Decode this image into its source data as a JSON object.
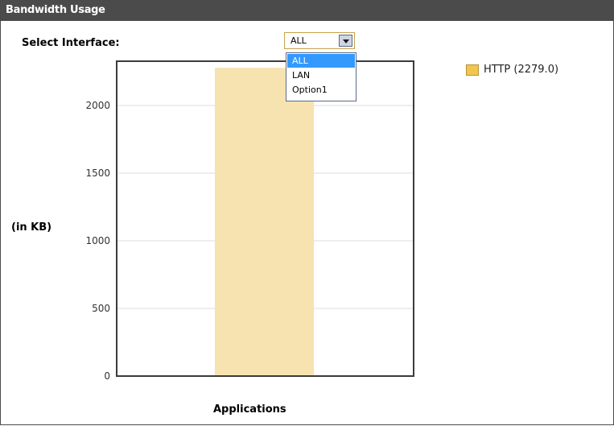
{
  "panel": {
    "title": "Bandwidth Usage",
    "select_label": "Select Interface:",
    "select": {
      "value": "ALL",
      "options": [
        "ALL",
        "LAN",
        "Option1"
      ],
      "selected_index": 0
    }
  },
  "chart_data": {
    "type": "bar",
    "categories": [
      "HTTP"
    ],
    "values": [
      2279.0
    ],
    "ylabel": "(in KB)",
    "xlabel": "Applications",
    "ylim": [
      0,
      2300
    ],
    "yticks": [
      "0",
      "500",
      "1000",
      "1500",
      "2000"
    ],
    "grid": true,
    "legend_placement": "top-right",
    "legend": [
      {
        "label": "HTTP (2279.0)",
        "color": "#f2c54e"
      }
    ],
    "bar_color": "#f7e3b0"
  }
}
